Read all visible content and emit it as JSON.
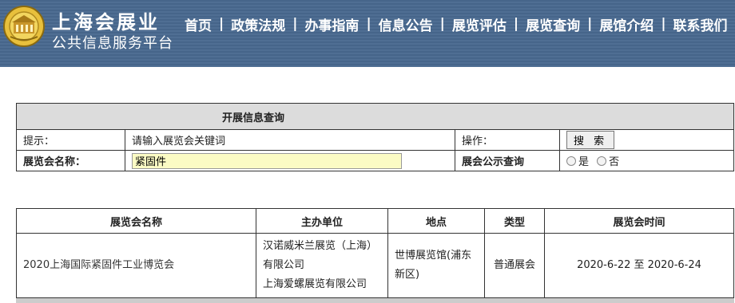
{
  "brand": {
    "title": "上海会展业",
    "subtitle": "公共信息服务平台"
  },
  "nav": {
    "items": [
      "首页",
      "政策法规",
      "办事指南",
      "信息公告",
      "展览评估",
      "展览查询",
      "展馆介绍",
      "联系我们"
    ],
    "separator": "|"
  },
  "search": {
    "title": "开展信息查询",
    "hint_label": "提示：",
    "hint_text": "请输入展览会关键词",
    "action_label": "操作：",
    "search_button": "搜 索",
    "name_label": "展览会名称：",
    "name_value": "紧固件",
    "public_label": "展会公示查询",
    "options": [
      "是",
      "否"
    ]
  },
  "results": {
    "headers": [
      "展览会名称",
      "主办单位",
      "地点",
      "类型",
      "展览会时间"
    ],
    "rows": [
      {
        "name": "2020上海国际紧固件工业博览会",
        "organizer_1": "汉诺威米兰展览（上海）有限公司",
        "organizer_2": "上海爱螺展览有限公司",
        "venue": "世博展览馆(浦东新区)",
        "type": "普通展会",
        "date": "2020-6-22 至 2020-6-24"
      }
    ]
  },
  "colors": {
    "header_bg": "#4f6e93",
    "input_bg": "#fbfbc4",
    "table_head_bg": "#dcdcdc"
  }
}
